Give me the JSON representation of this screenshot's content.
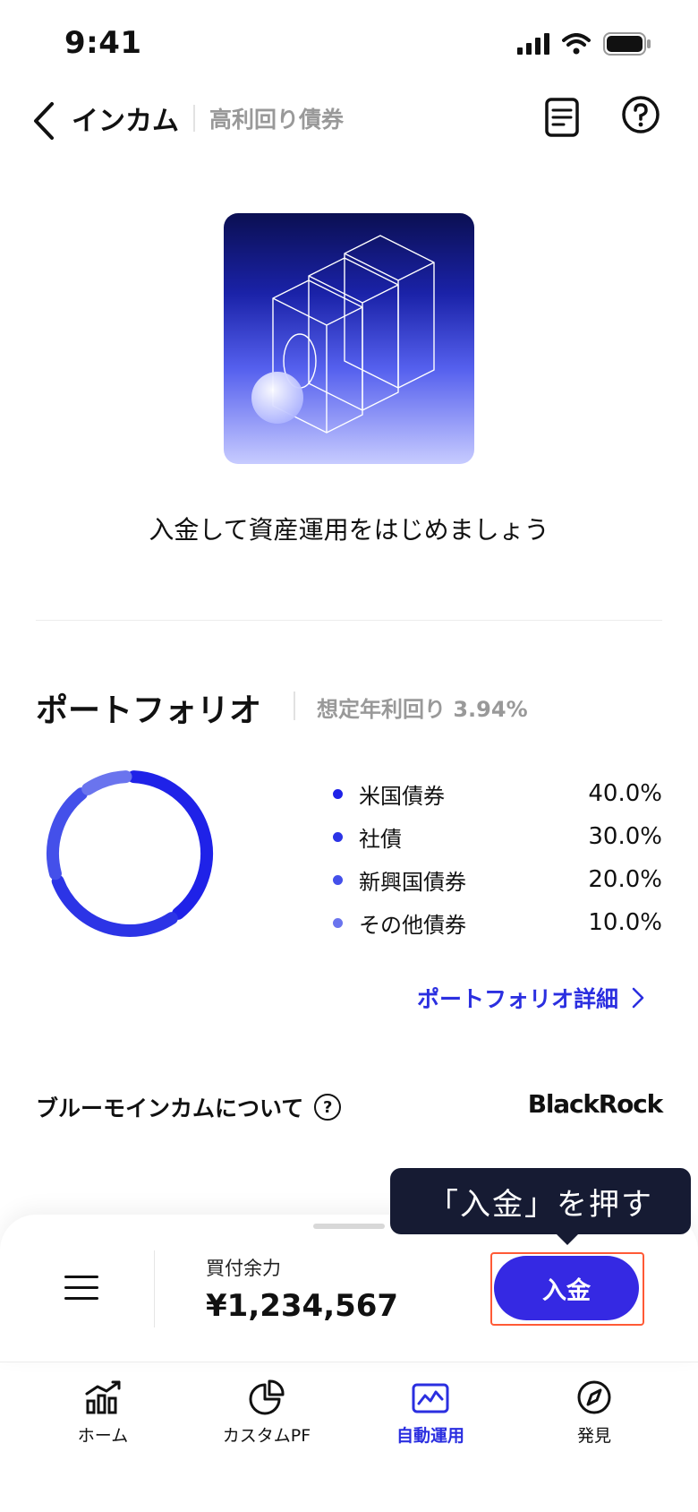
{
  "status_bar": {
    "time": "9:41"
  },
  "header": {
    "title": "インカム",
    "subtitle": "高利回り債券"
  },
  "hero": {
    "message": "入金して資産運用をはじめましょう"
  },
  "portfolio": {
    "title": "ポートフォリオ",
    "expected_yield": "想定年利回り 3.94%",
    "allocations": [
      {
        "label": "米国債券",
        "value": "40.0%",
        "share": 40,
        "color": "#1f22e8"
      },
      {
        "label": "社債",
        "value": "30.0%",
        "share": 30,
        "color": "#2c34e6"
      },
      {
        "label": "新興国債券",
        "value": "20.0%",
        "share": 20,
        "color": "#4450ea"
      },
      {
        "label": "その他債券",
        "value": "10.0%",
        "share": 10,
        "color": "#6a74ee"
      }
    ],
    "detail_link": "ポートフォリオ詳細"
  },
  "about": {
    "label": "ブルーモインカムについて",
    "brand": "BlackRock"
  },
  "bottom_sheet": {
    "buying_power_label": "買付余力",
    "buying_power_value": "¥1,234,567",
    "deposit_label": "入金",
    "tooltip": "「入金」を押す"
  },
  "tabs": [
    {
      "label": "ホーム",
      "icon": "bar-chart-icon",
      "active": false
    },
    {
      "label": "カスタムPF",
      "icon": "pie-chart-icon",
      "active": false
    },
    {
      "label": "自動運用",
      "icon": "line-chart-icon",
      "active": true
    },
    {
      "label": "発見",
      "icon": "compass-icon",
      "active": false
    }
  ]
}
